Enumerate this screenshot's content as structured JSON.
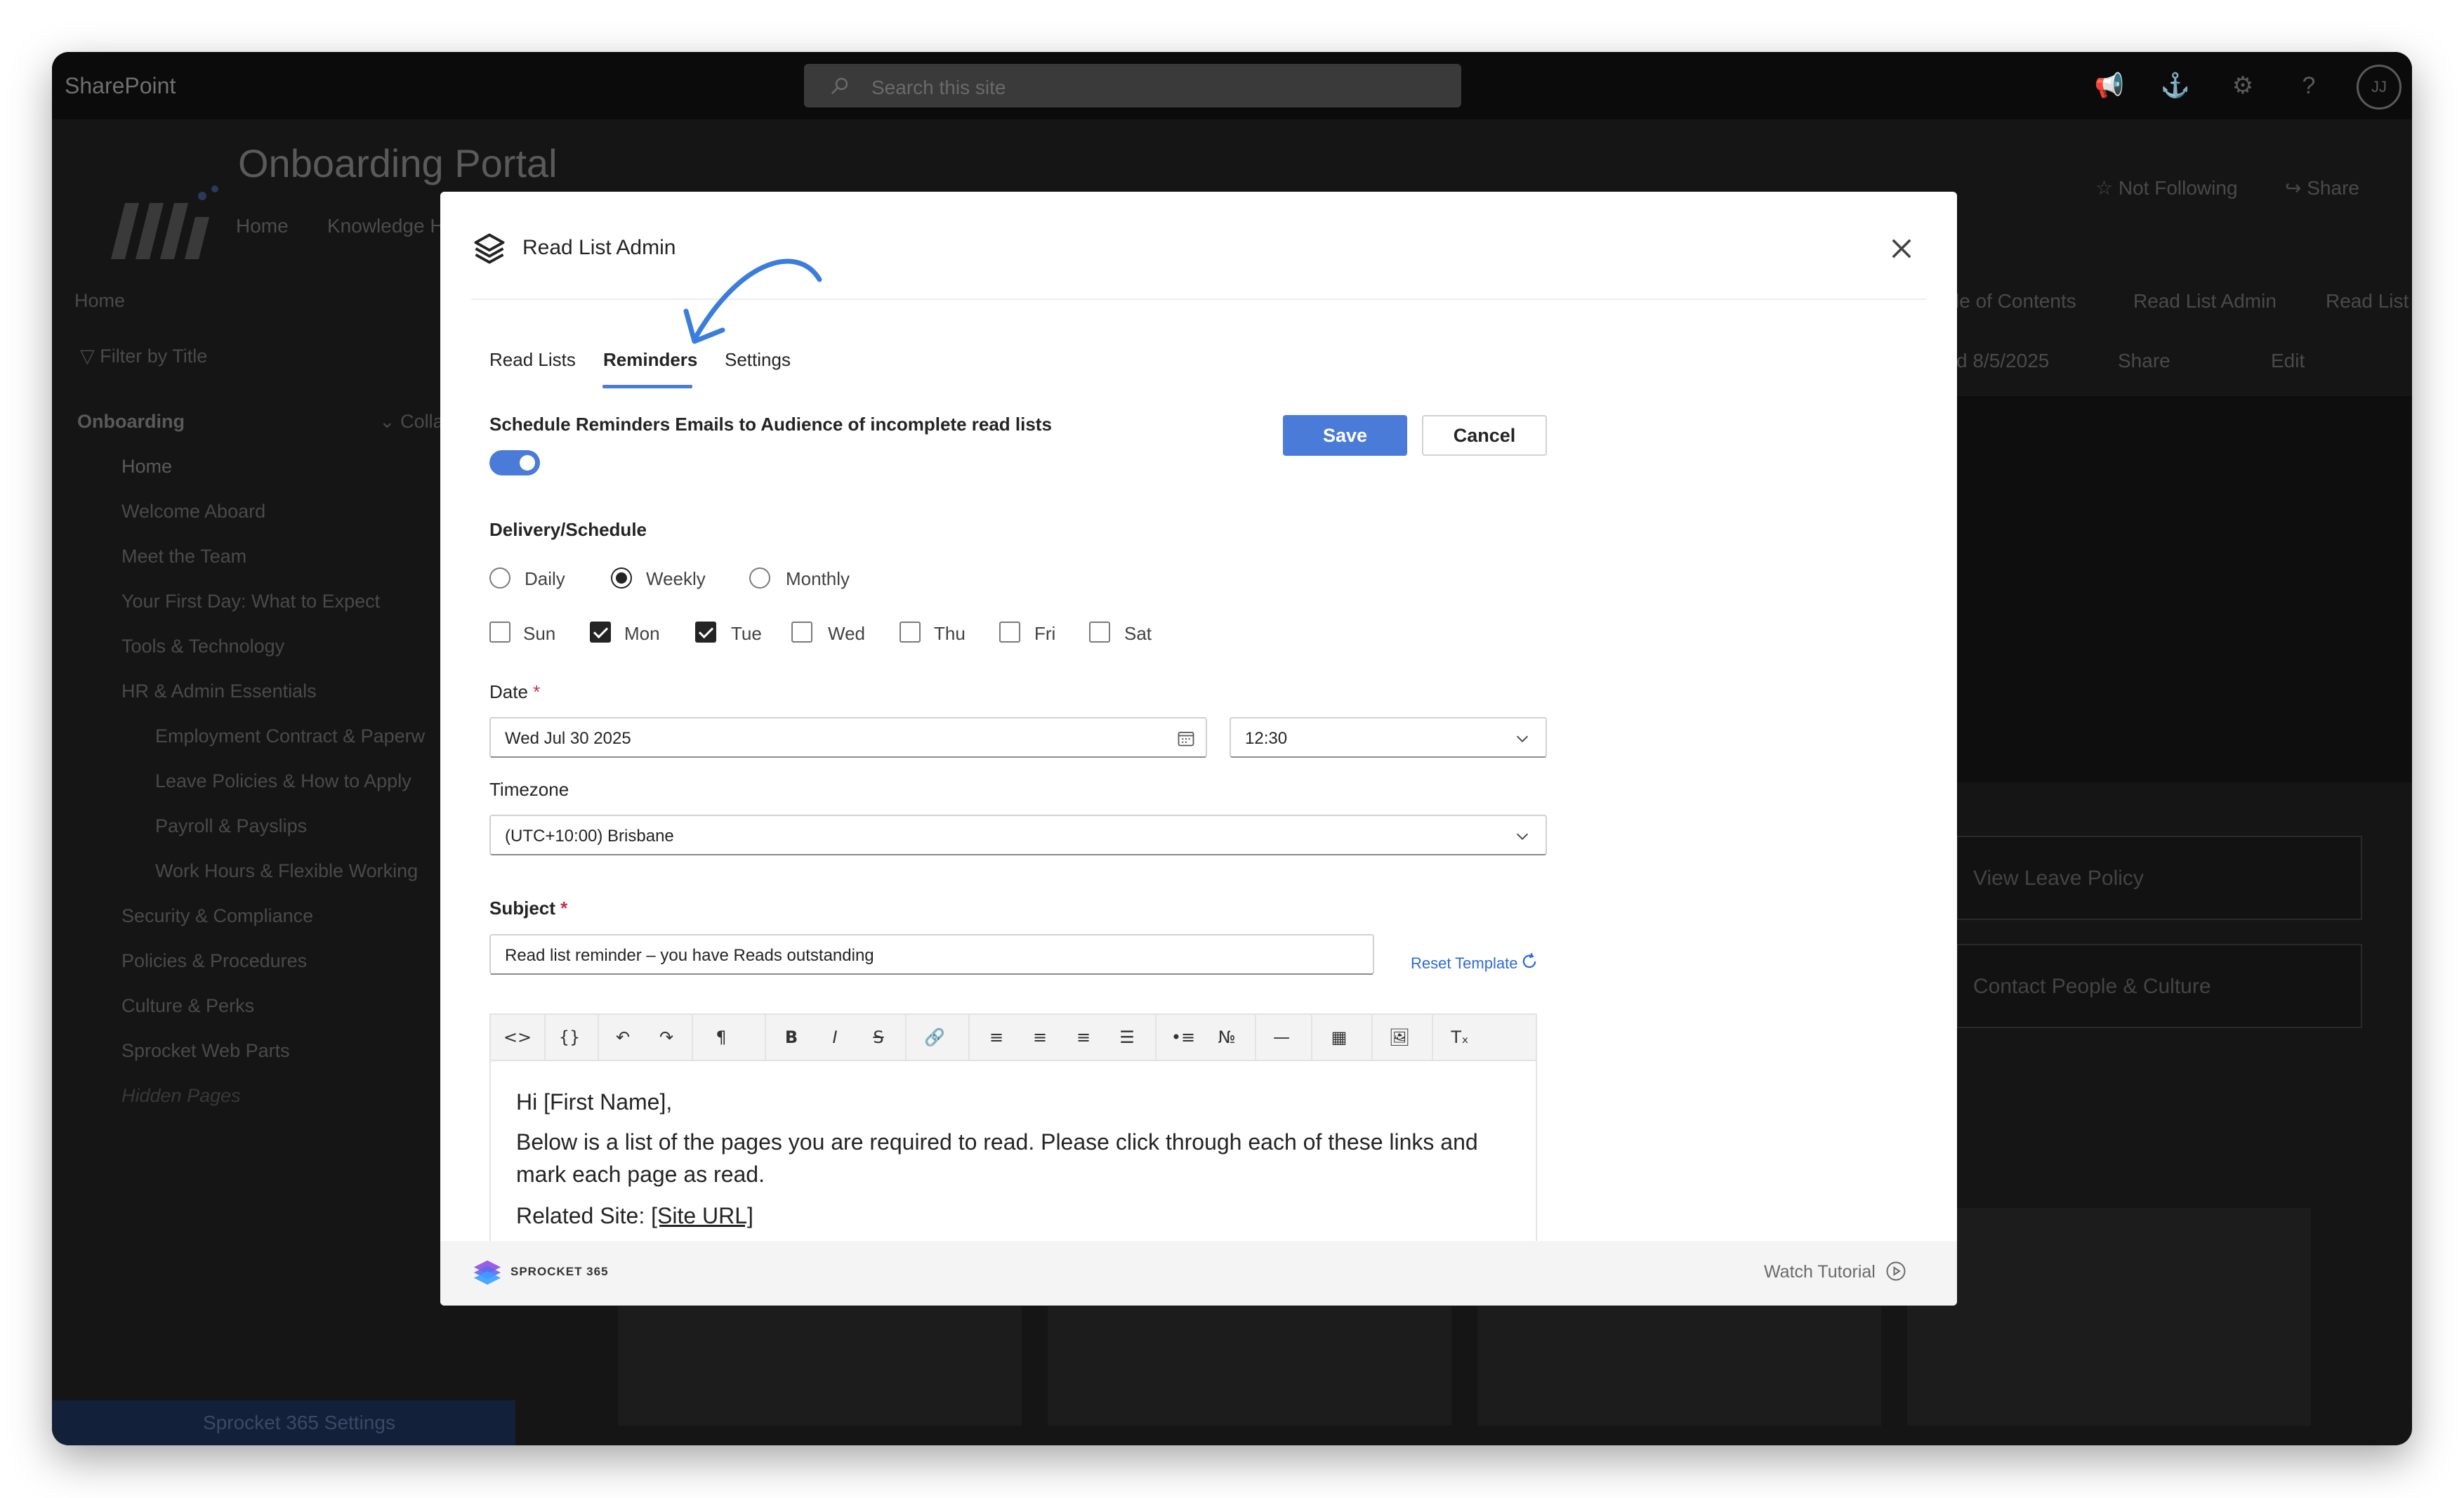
{
  "suite": {
    "brand": "SharePoint",
    "search_placeholder": "Search this site",
    "avatar_initials": "JJ"
  },
  "site": {
    "title": "Onboarding Portal",
    "nav": [
      "Home",
      "Knowledge H"
    ],
    "follow": "Not Following",
    "share": "Share"
  },
  "leftnav": {
    "home": "Home",
    "filter": "Filter by Title",
    "section": "Onboarding",
    "collapse": "Colla",
    "items": [
      "Home",
      "Welcome Aboard",
      "Meet the Team",
      "Your First Day: What to Expect",
      "Tools & Technology",
      "HR & Admin Essentials",
      "Employment Contract & Paperw",
      "Leave Policies & How to Apply",
      "Payroll & Payslips",
      "Work Hours & Flexible Working",
      "Security & Compliance",
      "Policies & Procedures",
      "Culture & Perks",
      "Sprocket Web Parts",
      "Hidden Pages"
    ],
    "footer": "Sprocket 365 Settings"
  },
  "page_bar": {
    "toc": "le of Contents",
    "read_list_admin": "Read List Admin",
    "read_list": "Read List",
    "date": "d 8/5/2025",
    "share": "Share",
    "edit": "Edit"
  },
  "cards": [
    "View Leave Policy",
    "Contact People & Culture"
  ],
  "modal": {
    "title": "Read List Admin",
    "tabs": [
      "Read Lists",
      "Reminders",
      "Settings"
    ],
    "active_tab": "Reminders",
    "schedule_label": "Schedule Reminders Emails to Audience of incomplete read lists",
    "toggle_on": true,
    "save": "Save",
    "cancel": "Cancel",
    "delivery_label": "Delivery/Schedule",
    "frequency": [
      {
        "label": "Daily",
        "checked": false
      },
      {
        "label": "Weekly",
        "checked": true
      },
      {
        "label": "Monthly",
        "checked": false
      }
    ],
    "days": [
      {
        "label": "Sun",
        "checked": false
      },
      {
        "label": "Mon",
        "checked": true
      },
      {
        "label": "Tue",
        "checked": true
      },
      {
        "label": "Wed",
        "checked": false
      },
      {
        "label": "Thu",
        "checked": false
      },
      {
        "label": "Fri",
        "checked": false
      },
      {
        "label": "Sat",
        "checked": false
      }
    ],
    "date_label": "Date",
    "required_mark": "*",
    "date_value": "Wed Jul 30 2025",
    "time_value": "12:30",
    "timezone_label": "Timezone",
    "timezone_value": "(UTC+10:00) Brisbane",
    "subject_label": "Subject",
    "subject_value": "Read list reminder – you have Reads  outstanding",
    "reset_template": "Reset Template",
    "editor": {
      "line1": "Hi [First Name],",
      "line2": "Below is a list of the pages you are required to read. Please click through each of these links and",
      "line3": "mark each page as read.",
      "line4_prefix": "Related Site: ",
      "line4_link": "[Site URL]"
    },
    "footer_brand": "SPROCKET 365",
    "watch_tutorial": "Watch Tutorial"
  },
  "colors": {
    "accent": "#4a7bd8",
    "link": "#2f6bd6",
    "required": "#c4314b"
  }
}
